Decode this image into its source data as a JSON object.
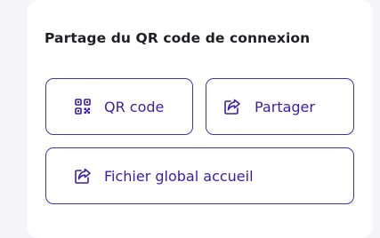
{
  "section": {
    "title": "Partage du QR code de connexion"
  },
  "buttons": {
    "qr_code": {
      "label": "QR code",
      "icon": "qr-code-icon"
    },
    "share": {
      "label": "Partager",
      "icon": "share-icon"
    },
    "global_file": {
      "label": "Fichier global accueil",
      "icon": "share-icon"
    }
  },
  "colors": {
    "accent": "#3a1ea8",
    "border": "#4a2fb0",
    "card_background": "#ffffff",
    "page_background": "#f4f4f9",
    "title_text": "#1f1f24"
  }
}
